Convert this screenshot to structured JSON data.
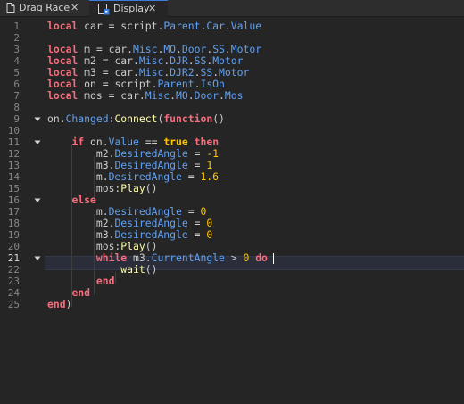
{
  "tabs": [
    {
      "label": "Drag Race",
      "icon": "script-icon",
      "close": "✕",
      "active": false
    },
    {
      "label": "Display",
      "icon": "local-script-icon",
      "close": "✕",
      "active": true
    }
  ],
  "editor": {
    "active_line": 21,
    "line_numbers": [
      "1",
      "2",
      "3",
      "4",
      "5",
      "6",
      "7",
      "8",
      "9",
      "10",
      "11",
      "12",
      "13",
      "14",
      "15",
      "16",
      "17",
      "18",
      "19",
      "20",
      "21",
      "22",
      "23",
      "24",
      "25"
    ],
    "fold_lines": [
      9,
      11,
      16,
      21
    ],
    "lines": [
      [
        [
          "kw",
          "local"
        ],
        [
          "id",
          " car = script."
        ],
        [
          "prop",
          "Parent"
        ],
        [
          "id",
          "."
        ],
        [
          "prop",
          "Car"
        ],
        [
          "id",
          "."
        ],
        [
          "prop",
          "Value"
        ]
      ],
      [],
      [
        [
          "kw",
          "local"
        ],
        [
          "id",
          " m = car."
        ],
        [
          "prop",
          "Misc"
        ],
        [
          "id",
          "."
        ],
        [
          "prop",
          "MO"
        ],
        [
          "id",
          "."
        ],
        [
          "prop",
          "Door"
        ],
        [
          "id",
          "."
        ],
        [
          "prop",
          "SS"
        ],
        [
          "id",
          "."
        ],
        [
          "prop",
          "Motor"
        ]
      ],
      [
        [
          "kw",
          "local"
        ],
        [
          "id",
          " m2 = car."
        ],
        [
          "prop",
          "Misc"
        ],
        [
          "id",
          "."
        ],
        [
          "prop",
          "DJR"
        ],
        [
          "id",
          "."
        ],
        [
          "prop",
          "SS"
        ],
        [
          "id",
          "."
        ],
        [
          "prop",
          "Motor"
        ]
      ],
      [
        [
          "kw",
          "local"
        ],
        [
          "id",
          " m3 = car."
        ],
        [
          "prop",
          "Misc"
        ],
        [
          "id",
          "."
        ],
        [
          "prop",
          "DJR2"
        ],
        [
          "id",
          "."
        ],
        [
          "prop",
          "SS"
        ],
        [
          "id",
          "."
        ],
        [
          "prop",
          "Motor"
        ]
      ],
      [
        [
          "kw",
          "local"
        ],
        [
          "id",
          " on = script."
        ],
        [
          "prop",
          "Parent"
        ],
        [
          "id",
          "."
        ],
        [
          "prop",
          "IsOn"
        ]
      ],
      [
        [
          "kw",
          "local"
        ],
        [
          "id",
          " mos = car."
        ],
        [
          "prop",
          "Misc"
        ],
        [
          "id",
          "."
        ],
        [
          "prop",
          "MO"
        ],
        [
          "id",
          "."
        ],
        [
          "prop",
          "Door"
        ],
        [
          "id",
          "."
        ],
        [
          "prop",
          "Mos"
        ]
      ],
      [],
      [
        [
          "id",
          "on."
        ],
        [
          "prop",
          "Changed"
        ],
        [
          "id",
          ":"
        ],
        [
          "fn",
          "Connect"
        ],
        [
          "id",
          "("
        ],
        [
          "kw",
          "function"
        ],
        [
          "id",
          "()"
        ]
      ],
      [],
      [
        [
          "id",
          "    "
        ],
        [
          "kw",
          "if"
        ],
        [
          "id",
          " on."
        ],
        [
          "prop",
          "Value"
        ],
        [
          "id",
          " == "
        ],
        [
          "kw-true",
          "true"
        ],
        [
          "id",
          " "
        ],
        [
          "kw",
          "then"
        ]
      ],
      [
        [
          "id",
          "        m2."
        ],
        [
          "prop",
          "DesiredAngle"
        ],
        [
          "id",
          " = "
        ],
        [
          "num",
          "-1"
        ]
      ],
      [
        [
          "id",
          "        m3."
        ],
        [
          "prop",
          "DesiredAngle"
        ],
        [
          "id",
          " = "
        ],
        [
          "num",
          "1"
        ]
      ],
      [
        [
          "id",
          "        m."
        ],
        [
          "prop",
          "DesiredAngle"
        ],
        [
          "id",
          " = "
        ],
        [
          "num",
          "1.6"
        ]
      ],
      [
        [
          "id",
          "        mos:"
        ],
        [
          "fn",
          "Play"
        ],
        [
          "id",
          "()"
        ]
      ],
      [
        [
          "id",
          "    "
        ],
        [
          "kw",
          "else"
        ]
      ],
      [
        [
          "id",
          "        m."
        ],
        [
          "prop",
          "DesiredAngle"
        ],
        [
          "id",
          " = "
        ],
        [
          "num",
          "0"
        ]
      ],
      [
        [
          "id",
          "        m2."
        ],
        [
          "prop",
          "DesiredAngle"
        ],
        [
          "id",
          " = "
        ],
        [
          "num",
          "0"
        ]
      ],
      [
        [
          "id",
          "        m3."
        ],
        [
          "prop",
          "DesiredAngle"
        ],
        [
          "id",
          " = "
        ],
        [
          "num",
          "0"
        ]
      ],
      [
        [
          "id",
          "        mos:"
        ],
        [
          "fn",
          "Play"
        ],
        [
          "id",
          "()"
        ]
      ],
      [
        [
          "id",
          "        "
        ],
        [
          "kw",
          "while"
        ],
        [
          "id",
          " m3."
        ],
        [
          "prop",
          "CurrentAngle"
        ],
        [
          "id",
          " > "
        ],
        [
          "num",
          "0"
        ],
        [
          "id",
          " "
        ],
        [
          "kw",
          "do"
        ],
        [
          "id",
          " "
        ]
      ],
      [
        [
          "id",
          "            "
        ],
        [
          "fn",
          "wait"
        ],
        [
          "id",
          "()"
        ]
      ],
      [
        [
          "id",
          "        "
        ],
        [
          "kw",
          "end"
        ]
      ],
      [
        [
          "id",
          "    "
        ],
        [
          "kw",
          "end"
        ]
      ],
      [
        [
          "kw",
          "end"
        ],
        [
          "id",
          ")"
        ]
      ]
    ]
  }
}
